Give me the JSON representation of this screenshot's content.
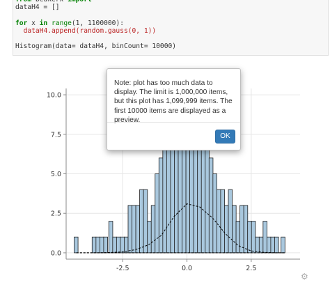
{
  "code_cell": {
    "line1": {
      "kw1": "from",
      "module": "beakerx",
      "kw2": "import",
      "star": "*"
    },
    "line2": "dataH4 = []",
    "line4": {
      "kw": "for",
      "var": "x",
      "kw_in": "in",
      "fn": "range",
      "args": "(1, 1100000):"
    },
    "line5": {
      "prefix": "dataH4.append(random.gauss(0, 1))"
    },
    "line7": "Histogram(data= dataH4, binCount= 10000)"
  },
  "modal": {
    "message": "Note: plot has too much data to display. The limit is 1,000,000 items, but this plot has 1,099,999 items. The first 10000 items are displayed as a preview.",
    "ok_label": "OK"
  },
  "chart_data": {
    "type": "bar",
    "title": "",
    "xlabel": "",
    "ylabel": "",
    "xlim": [
      -4.7,
      4.4
    ],
    "ylim": [
      -0.4,
      10.4
    ],
    "x_ticks": [
      "-2.5",
      "0.0",
      "2.5"
    ],
    "y_ticks": [
      "0.0",
      "2.5",
      "5.0",
      "7.5",
      "10.0"
    ],
    "grid": true,
    "bin_width": 0.18,
    "bars": [
      [
        -4.3,
        1
      ],
      [
        -3.8,
        0
      ],
      [
        -3.6,
        1
      ],
      [
        -3.45,
        1
      ],
      [
        -3.3,
        1
      ],
      [
        -3.15,
        1
      ],
      [
        -2.95,
        2
      ],
      [
        -2.8,
        1
      ],
      [
        -2.65,
        1
      ],
      [
        -2.5,
        1
      ],
      [
        -2.35,
        1
      ],
      [
        -2.2,
        3
      ],
      [
        -2.05,
        3
      ],
      [
        -1.9,
        3
      ],
      [
        -1.75,
        4
      ],
      [
        -1.6,
        4
      ],
      [
        -1.45,
        2
      ],
      [
        -1.3,
        3
      ],
      [
        -1.15,
        5
      ],
      [
        -1.0,
        6
      ],
      [
        -0.85,
        7
      ],
      [
        -0.7,
        8
      ],
      [
        -0.55,
        9
      ],
      [
        -0.4,
        9
      ],
      [
        -0.25,
        8
      ],
      [
        -0.1,
        9
      ],
      [
        0.05,
        8
      ],
      [
        0.2,
        9
      ],
      [
        0.35,
        7
      ],
      [
        0.5,
        8
      ],
      [
        0.65,
        9
      ],
      [
        0.8,
        7
      ],
      [
        0.95,
        6
      ],
      [
        1.1,
        5
      ],
      [
        1.25,
        4
      ],
      [
        1.4,
        4
      ],
      [
        1.55,
        3
      ],
      [
        1.7,
        4
      ],
      [
        1.85,
        3
      ],
      [
        2.0,
        2
      ],
      [
        2.15,
        3
      ],
      [
        2.3,
        3
      ],
      [
        2.45,
        2
      ],
      [
        2.6,
        2
      ],
      [
        2.75,
        1
      ],
      [
        2.9,
        1
      ],
      [
        3.05,
        2
      ],
      [
        3.2,
        1
      ],
      [
        3.35,
        1
      ],
      [
        3.5,
        1
      ],
      [
        3.75,
        1
      ]
    ],
    "curve": {
      "x": [
        -4.3,
        -3.5,
        -3.0,
        -2.5,
        -2.0,
        -1.5,
        -1.0,
        -0.5,
        0.0,
        0.5,
        1.0,
        1.5,
        2.0,
        2.5,
        3.0,
        3.5,
        3.8
      ],
      "y": [
        0.0,
        0.0,
        0.02,
        0.06,
        0.2,
        0.5,
        1.1,
        2.3,
        3.1,
        2.9,
        2.2,
        1.2,
        0.45,
        0.12,
        0.03,
        0.0,
        0.0
      ]
    },
    "colors": {
      "bar_fill": "#a9c8de",
      "bar_stroke": "#1f1f1f",
      "curve": "#000000",
      "grid": "#e6e6e6"
    }
  }
}
